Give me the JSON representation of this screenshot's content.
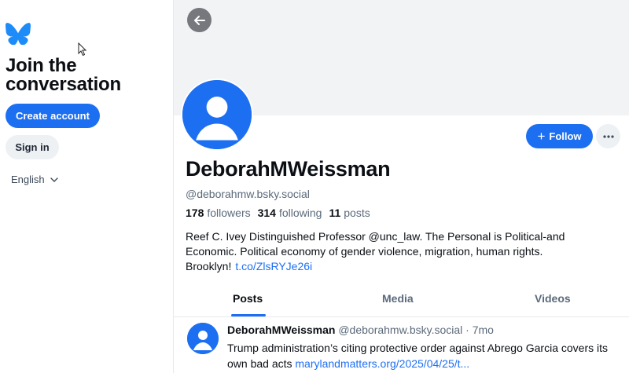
{
  "sidebar": {
    "logo_icon": "butterfly-icon",
    "title_line1": "Join the",
    "title_line2": "conversation",
    "create_account": "Create account",
    "sign_in": "Sign in",
    "language": "English"
  },
  "profile": {
    "back_icon": "arrow-left-icon",
    "display_name": "DeborahMWeissman",
    "handle": "@deborahmw.bsky.social",
    "followers_count": "178",
    "followers_label": "followers",
    "following_count": "314",
    "following_label": "following",
    "posts_count": "11",
    "posts_label": "posts",
    "follow_label": "Follow",
    "bio_text": "Reef C. Ivey Distinguished Professor @unc_law. The Personal is Political-and Economic. Political economy of gender violence, migration, human rights. Brooklyn!",
    "bio_link": "t.co/ZlsRYJe26i"
  },
  "tabs": [
    {
      "label": "Posts",
      "active": true
    },
    {
      "label": "Media",
      "active": false
    },
    {
      "label": "Videos",
      "active": false
    }
  ],
  "post": {
    "author": "DeborahMWeissman",
    "handle": "@deborahmw.bsky.social",
    "separator": "·",
    "time": "7mo",
    "text": "Trump administration’s citing protective order against Abrego Garcia covers its own bad acts",
    "link": "marylandmatters.org/2025/04/25/t..."
  },
  "colors": {
    "accent": "#1d6ff2",
    "banner": "#f1f3f5",
    "muted_text": "#5b6a7b"
  }
}
